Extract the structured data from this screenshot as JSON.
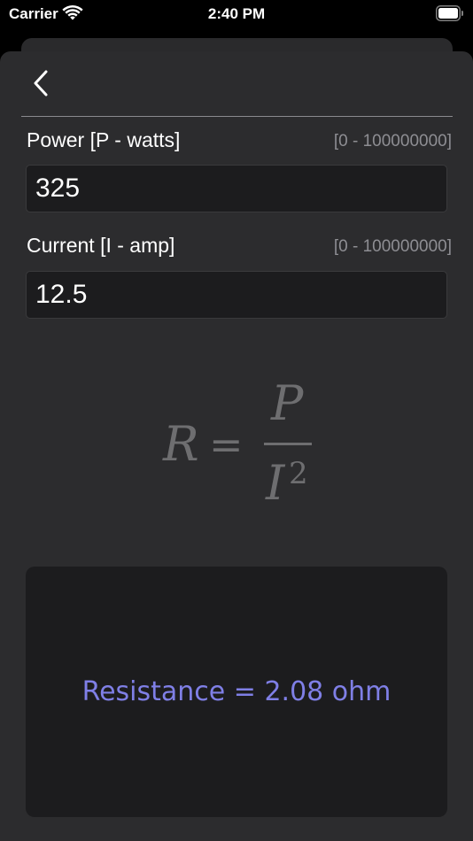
{
  "status_bar": {
    "carrier": "Carrier",
    "time": "2:40 PM"
  },
  "fields": [
    {
      "label": "Power [P - watts]",
      "range": "[0 - 100000000]",
      "value": "325"
    },
    {
      "label": "Current [I - amp]",
      "range": "[0 - 100000000]",
      "value": "12.5"
    }
  ],
  "formula": {
    "lhs": "R",
    "equals": "=",
    "numerator": "P",
    "denominator": "I",
    "exponent": "2"
  },
  "result": {
    "text": "Resistance = 2.08 ohm"
  },
  "colors": {
    "background": "#2c2c2e",
    "input_background": "#1c1c1e",
    "result_text": "#7f7fe6",
    "formula_text": "#6e6e70"
  }
}
